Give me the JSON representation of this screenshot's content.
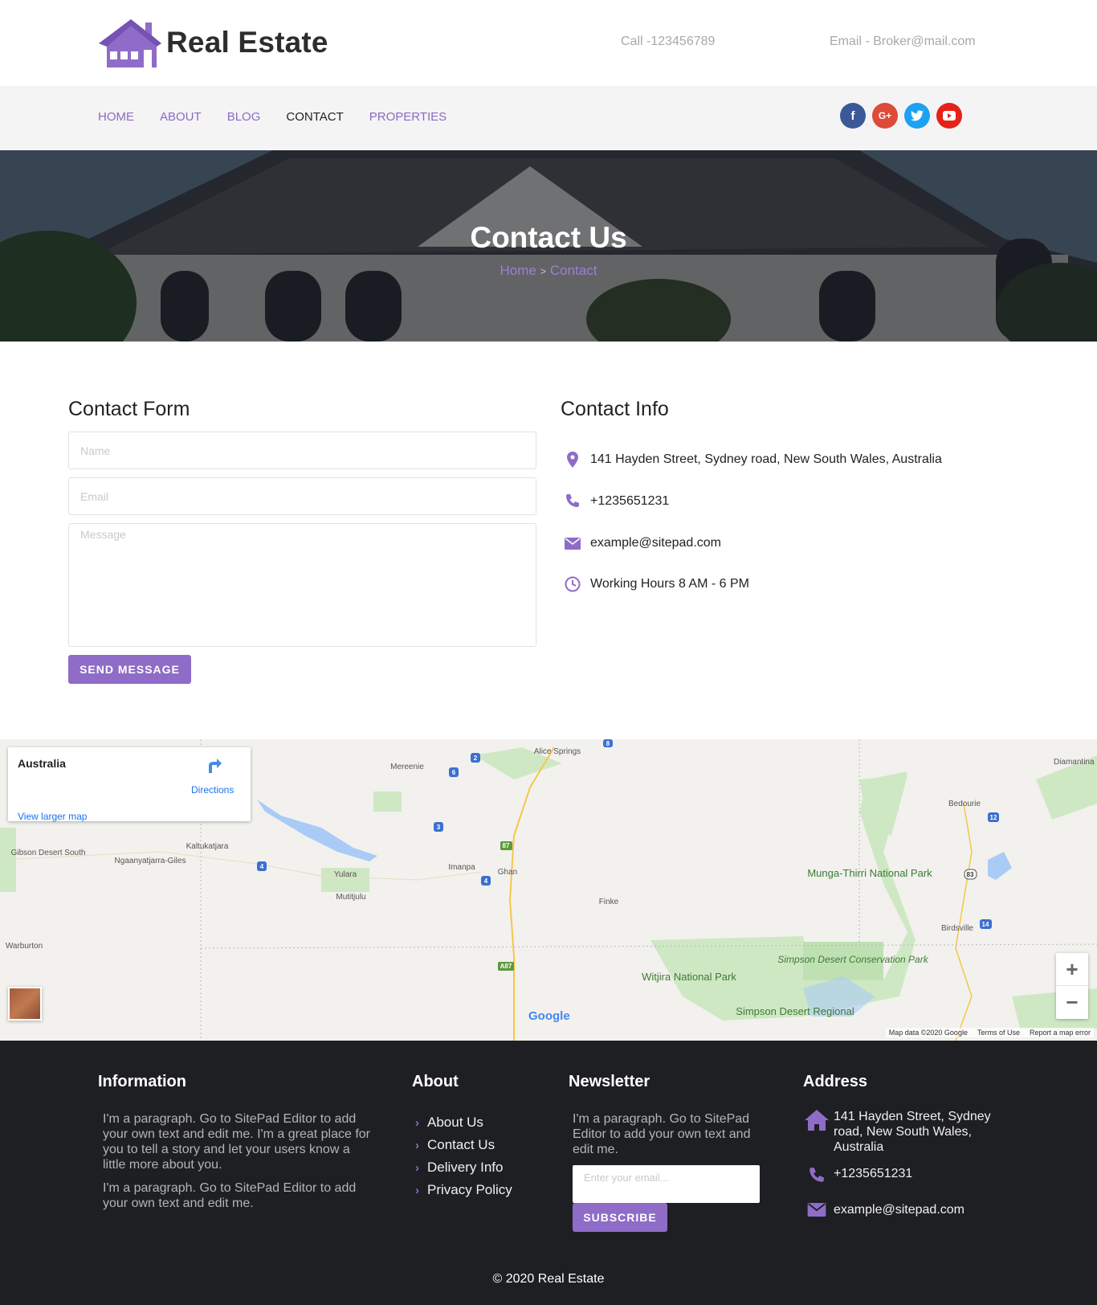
{
  "header": {
    "brand": "Real Estate",
    "call": "Call -123456789",
    "email": "Email - Broker@mail.com"
  },
  "nav": {
    "items": [
      "HOME",
      "ABOUT",
      "BLOG",
      "CONTACT",
      "PROPERTIES"
    ],
    "active": "CONTACT"
  },
  "socials": [
    "facebook-icon",
    "google-plus-icon",
    "twitter-icon",
    "youtube-icon"
  ],
  "hero": {
    "title": "Contact Us",
    "crumb_home": "Home",
    "crumb_sep": ">",
    "crumb_current": "Contact"
  },
  "contact_form": {
    "title": "Contact Form",
    "name_placeholder": "Name",
    "email_placeholder": "Email",
    "message_placeholder": "Message",
    "send_label": "SEND MESSAGE"
  },
  "contact_info": {
    "title": "Contact Info",
    "address": "141 Hayden Street, Sydney road, New South Wales, Australia",
    "phone": "+1235651231",
    "email": "example@sitepad.com",
    "hours": "Working Hours 8 AM - 6 PM"
  },
  "map": {
    "place": "Australia",
    "directions": "Directions",
    "view_larger": "View larger map",
    "labels": [
      "Alice Springs",
      "Mereenie",
      "Gibson Desert South",
      "Ngaanyatjarra-Giles",
      "Kaltukatjara",
      "Yulara",
      "Mutitjulu",
      "Imanpa",
      "Ghan",
      "Finke",
      "Warburton",
      "Witjira National Park",
      "Simpson Desert Conservation Park",
      "Simpson Desert Regional",
      "Munga-Thirri National Park",
      "Bedourie",
      "Birdsville",
      "Diamantina Lakes"
    ],
    "road_shields": [
      "2",
      "6",
      "3",
      "4",
      "4",
      "87",
      "A87",
      "8",
      "12",
      "83",
      "14"
    ],
    "google": "Google",
    "footer_links": [
      "Map data ©2020 Google",
      "Terms of Use",
      "Report a map error"
    ],
    "colors": {
      "land": "#f2f1ee",
      "park": "#cfe8c4",
      "water": "#aacbf5",
      "road": "#f6c64a"
    }
  },
  "footer": {
    "info_title": "Information",
    "info_p1": "I'm a paragraph. Go to SitePad Editor to add your own text and edit me. I'm a great place for you to tell a story and let your users know a little more about you.",
    "info_p2": "I'm a paragraph. Go to SitePad Editor to add your own text and edit me.",
    "about_title": "About",
    "about_links": [
      "About Us",
      "Contact Us",
      "Delivery Info",
      "Privacy Policy"
    ],
    "newsletter_title": "Newsletter",
    "newsletter_text": "I'm a paragraph. Go to SitePad Editor to add your own text and edit me.",
    "newsletter_placeholder": "Enter your email...",
    "subscribe_label": "SUBSCRIBE",
    "address_title": "Address",
    "address": "141 Hayden Street, Sydney road, New South Wales, Australia",
    "phone": "+1235651231",
    "email": "example@sitepad.com",
    "copyright": "© 2020 Real Estate"
  },
  "colors": {
    "accent": "#8e6cc7",
    "footer_bg": "#1e1f22",
    "nav_bg": "#f4f4f4"
  }
}
